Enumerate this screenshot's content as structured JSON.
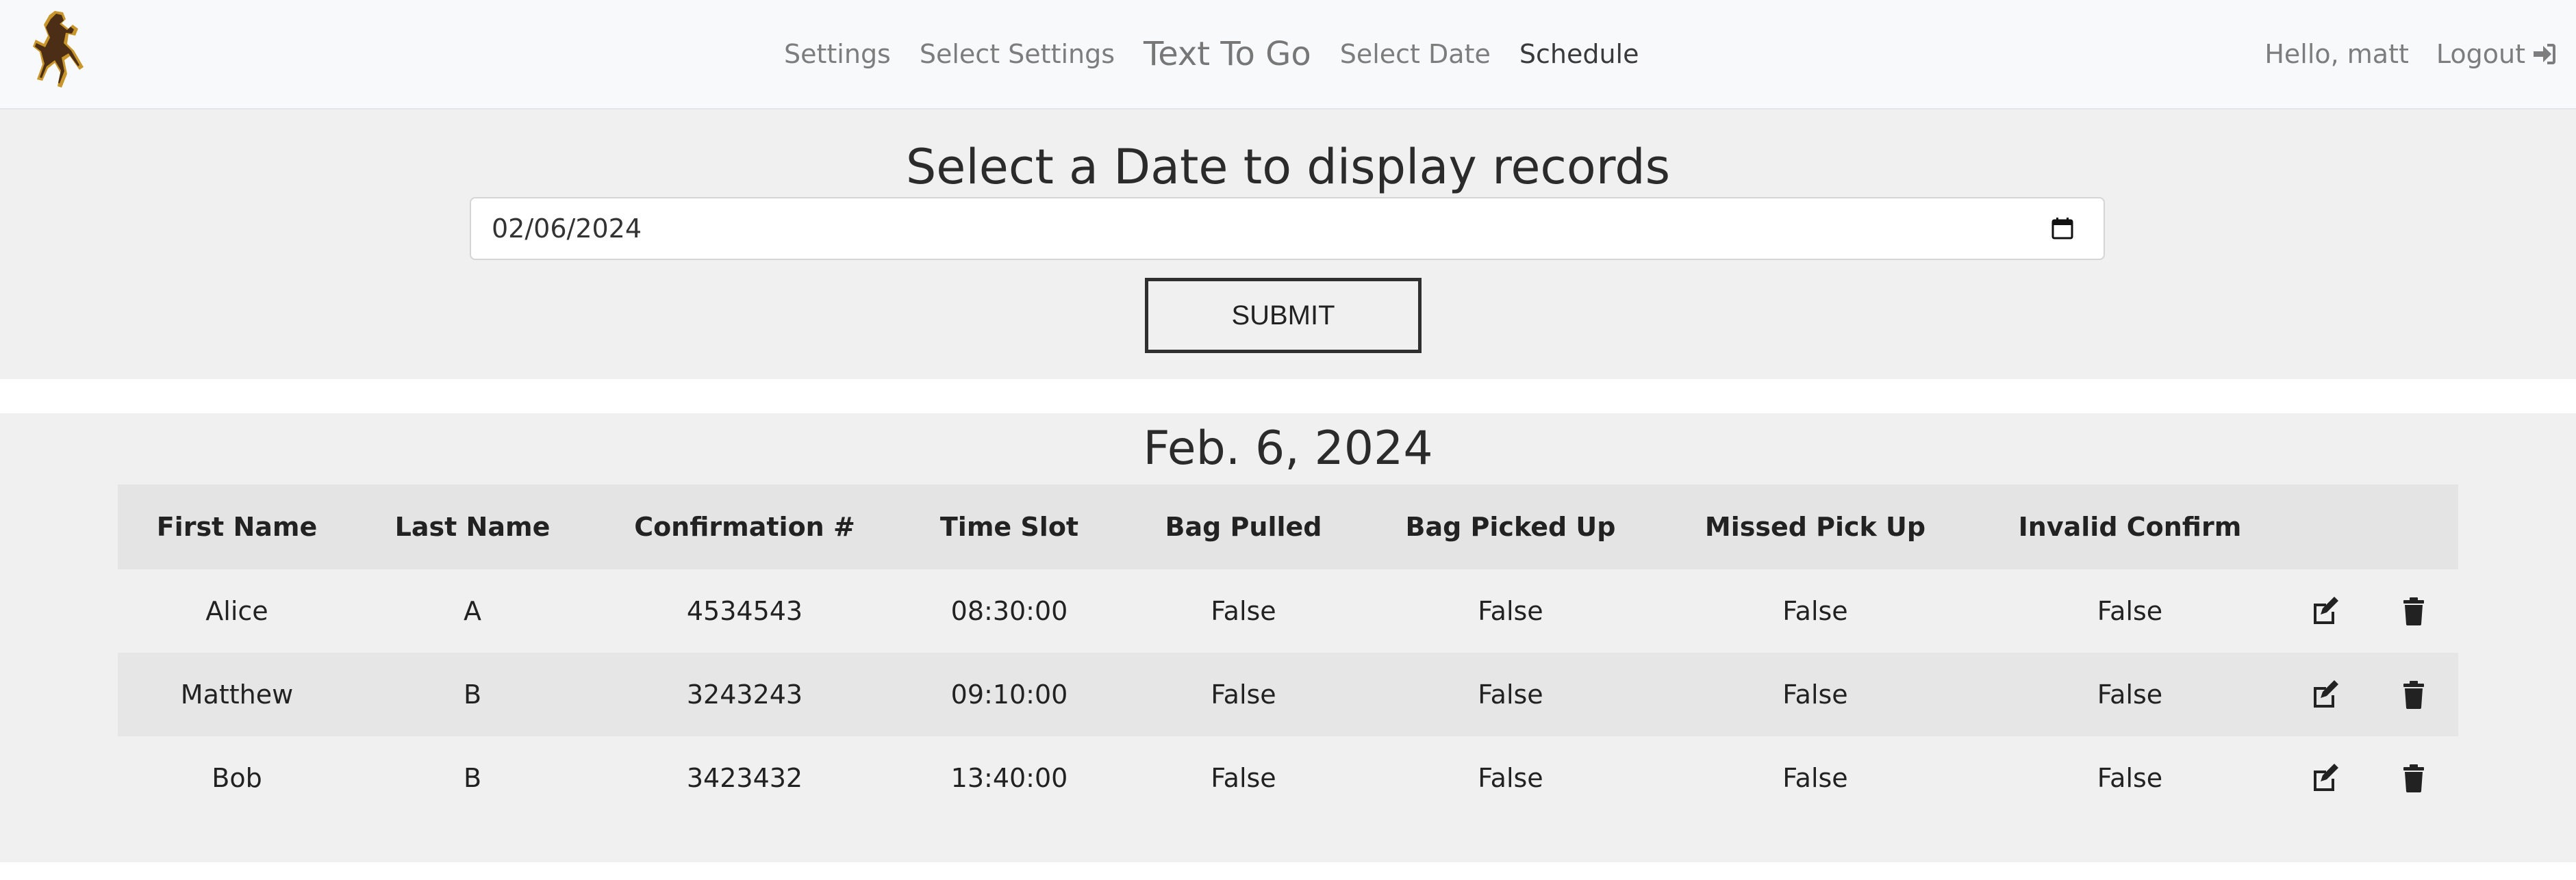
{
  "nav": {
    "links": [
      "Settings",
      "Select Settings",
      "Text To Go",
      "Select Date",
      "Schedule"
    ],
    "greeting": "Hello, matt",
    "logout": "Logout"
  },
  "form": {
    "title": "Select a Date to display records",
    "date_value": "02/06/2024",
    "submit_label": "SUBMIT"
  },
  "results": {
    "date_heading": "Feb. 6, 2024",
    "columns": [
      "First Name",
      "Last Name",
      "Confirmation #",
      "Time Slot",
      "Bag Pulled",
      "Bag Picked Up",
      "Missed Pick Up",
      "Invalid Confirm"
    ],
    "rows": [
      {
        "first": "Alice",
        "last": "A",
        "confirmation": "4534543",
        "time": "08:30:00",
        "bag_pulled": "False",
        "bag_picked_up": "False",
        "missed": "False",
        "invalid": "False"
      },
      {
        "first": "Matthew",
        "last": "B",
        "confirmation": "3243243",
        "time": "09:10:00",
        "bag_pulled": "False",
        "bag_picked_up": "False",
        "missed": "False",
        "invalid": "False"
      },
      {
        "first": "Bob",
        "last": "B",
        "confirmation": "3423432",
        "time": "13:40:00",
        "bag_pulled": "False",
        "bag_picked_up": "False",
        "missed": "False",
        "invalid": "False"
      }
    ]
  },
  "icons": {
    "logo": "bucking-horse-logo",
    "logout": "sign-in-icon",
    "calendar": "calendar-icon",
    "edit": "edit-icon",
    "delete": "trash-icon"
  },
  "colors": {
    "logo_brown": "#4b2e15",
    "logo_gold": "#c8962a",
    "section_bg": "#f0f0f0",
    "navbar_bg": "#f8f9fa"
  }
}
